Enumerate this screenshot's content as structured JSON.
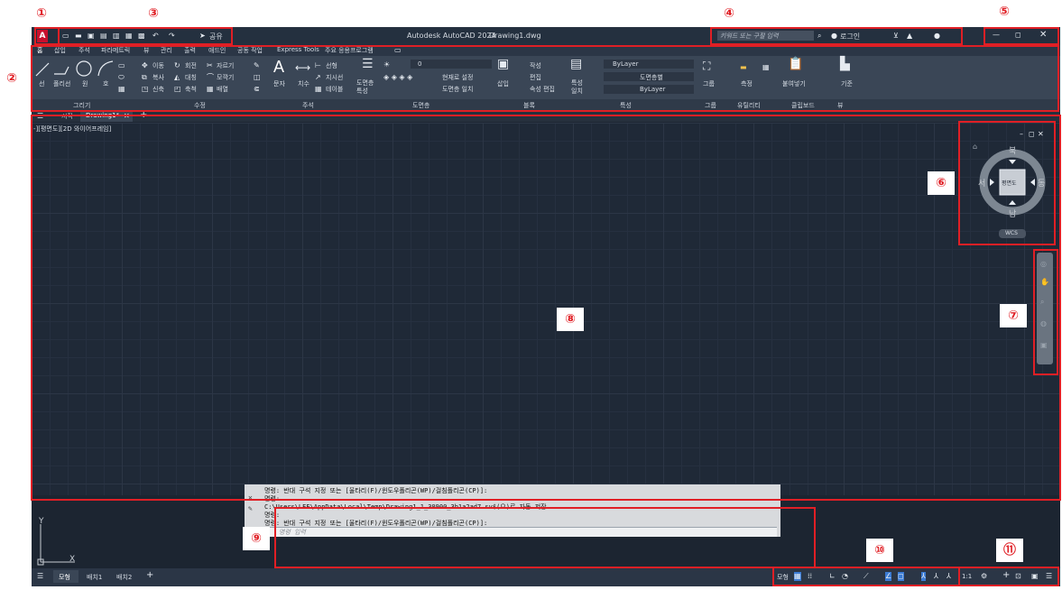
{
  "annotations": {
    "n1": "①",
    "n2": "②",
    "n3": "③",
    "n4": "④",
    "n5": "⑤",
    "n6": "⑥",
    "n7": "⑦",
    "n8": "⑧",
    "n9": "⑨",
    "n10": "⑩",
    "n11": "⑪",
    "color": "#e01f25"
  },
  "title": {
    "app": "Autodesk AutoCAD 2024",
    "file": "Drawing1.dwg",
    "app_button": "A",
    "share": "공유",
    "search_placeholder": "키워드 또는 구절 입력",
    "login": "로그인"
  },
  "ribbon_tabs": [
    "홈",
    "삽입",
    "주석",
    "파라메트릭",
    "뷰",
    "관리",
    "출력",
    "애드인",
    "공동 작업",
    "Express Tools",
    "주요 응용프로그램"
  ],
  "ribbon": {
    "draw": {
      "line": "선",
      "polyline": "폴리선",
      "circle": "원",
      "arc": "호",
      "panel": "그리기"
    },
    "modify": {
      "move": "이동",
      "rotate": "회전",
      "trim": "자르기",
      "copy": "복사",
      "mirror": "대칭",
      "fillet": "모깍기",
      "stretch": "신축",
      "scale": "축척",
      "array": "배열",
      "panel": "수정"
    },
    "annotation": {
      "text": "문자",
      "dimension": "치수",
      "linear": "선형",
      "leader": "지시선",
      "table": "테이블",
      "panel": "주석"
    },
    "layers": {
      "layer_props": "도면층 특성",
      "layer_value": "0",
      "make_current": "현재로 설정",
      "match_layer": "도면층 일치",
      "panel": "도면층"
    },
    "block": {
      "insert": "삽입",
      "create": "작성",
      "edit": "편집",
      "edit_attributes": "속성 편집",
      "panel": "블록"
    },
    "properties": {
      "match": "특성 일치",
      "color": "ByLayer",
      "linetype": "도면층별",
      "lineweight": "ByLayer",
      "panel": "특성"
    },
    "groups": {
      "group": "그룹",
      "panel": "그룹"
    },
    "utilities": {
      "measure": "측정",
      "panel": "유틸리티"
    },
    "clipboard": {
      "paste": "붙여넣기",
      "panel": "클립보드"
    },
    "view": {
      "base": "기준",
      "panel": "뷰"
    }
  },
  "doc_tabs": {
    "start": "시작",
    "drawing": "Drawing1*"
  },
  "viewport_label": "-][평면도][2D 와이어프레임]",
  "viewcube": {
    "north": "북",
    "south": "남",
    "east": "동",
    "west": "서",
    "face": "평면도",
    "wcs": "WCS"
  },
  "ucs": {
    "x": "X",
    "y": "Y"
  },
  "command": {
    "lines": [
      "명령: 반대 구석 지정 또는 [울타리(F)/윈도우폴리곤(WP)/걸침폴리곤(CP)]:",
      "명령:",
      "C:\\Users\\LEE\\AppData\\Local\\Temp\\Drawing1_1_30900_3b1a2ad7.sv$(으)로 자동 저장 ...",
      "명령:",
      "명령: 반대 구석 지정 또는 [울타리(F)/윈도우폴리곤(WP)/걸침폴리곤(CP)]:"
    ],
    "placeholder": "명령 입력"
  },
  "layout_tabs": {
    "model": "모형",
    "layout1": "배치1",
    "layout2": "배치2"
  },
  "status": {
    "model": "모형",
    "scale": "1:1"
  }
}
